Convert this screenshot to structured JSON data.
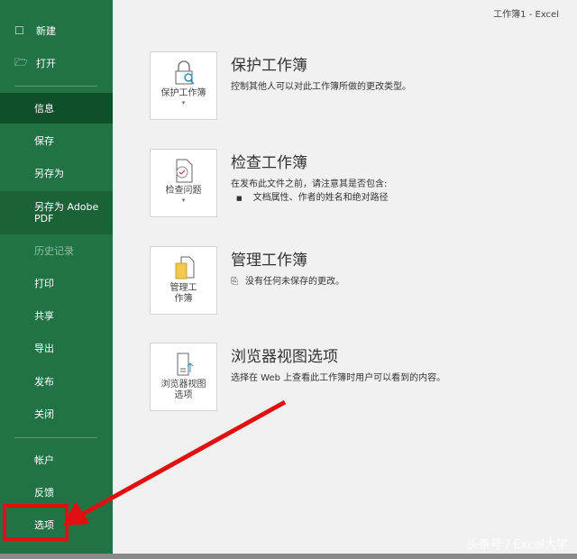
{
  "window_title": "工作簿1  -  Excel",
  "sidebar": {
    "items": [
      {
        "label": "新建",
        "icon": "new-doc-icon"
      },
      {
        "label": "打开",
        "icon": "folder-open-icon"
      },
      {
        "label": "信息",
        "selected": true
      },
      {
        "label": "保存"
      },
      {
        "label": "另存为"
      },
      {
        "label": "另存为 Adobe PDF"
      },
      {
        "label": "历史记录",
        "disabled": true
      },
      {
        "label": "打印"
      },
      {
        "label": "共享"
      },
      {
        "label": "导出"
      },
      {
        "label": "发布"
      },
      {
        "label": "关闭"
      },
      {
        "label": "帐户"
      },
      {
        "label": "反馈"
      },
      {
        "label": "选项"
      }
    ]
  },
  "sections": [
    {
      "button": "保护工作簿",
      "title": "保护工作簿",
      "desc": "控制其他人可以对此工作簿所做的更改类型。"
    },
    {
      "button": "检查问题",
      "title": "检查工作簿",
      "desc": "在发布此文件之前，请注意其是否包含:",
      "bullet": "文档属性、作者的姓名和绝对路径"
    },
    {
      "button": "管理工作簿",
      "title": "管理工作簿",
      "desc": "没有任何未保存的更改。"
    },
    {
      "button": "浏览器视图选项",
      "title": "浏览器视图选项",
      "desc": "选择在 Web 上查看此工作簿时用户可以看到的内容。"
    }
  ],
  "watermark": "头条号 / Excel大学",
  "annotation_color": "#e01010"
}
